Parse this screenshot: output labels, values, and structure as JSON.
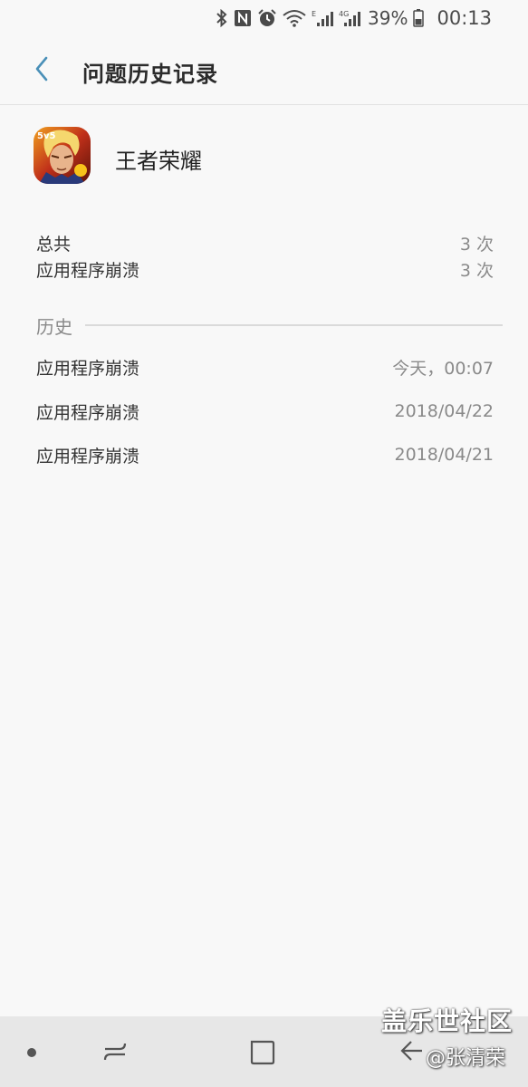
{
  "status_bar": {
    "battery": "39%",
    "time": "00:13",
    "icons": [
      "bluetooth-icon",
      "nfc-icon",
      "alarm-icon",
      "wifi-icon",
      "signal-e-icon",
      "signal-4g-icon",
      "battery-icon"
    ]
  },
  "header": {
    "title": "问题历史记录",
    "back_icon": "chevron-left-icon",
    "accent_color": "#4a90b8"
  },
  "app": {
    "name": "王者荣耀",
    "icon": "game-app-icon"
  },
  "summary": {
    "items": [
      {
        "label": "总共",
        "value": "3 次"
      },
      {
        "label": "应用程序崩溃",
        "value": "3 次"
      }
    ]
  },
  "history": {
    "title": "历史",
    "items": [
      {
        "label": "应用程序崩溃",
        "date": "今天，00:07"
      },
      {
        "label": "应用程序崩溃",
        "date": "2018/04/22"
      },
      {
        "label": "应用程序崩溃",
        "date": "2018/04/21"
      }
    ]
  },
  "nav_bar": {
    "icons": [
      "dot-icon",
      "recents-icon",
      "home-icon",
      "back-icon"
    ]
  },
  "watermark": {
    "title": "盖乐世社区",
    "author": "@张清荣"
  }
}
